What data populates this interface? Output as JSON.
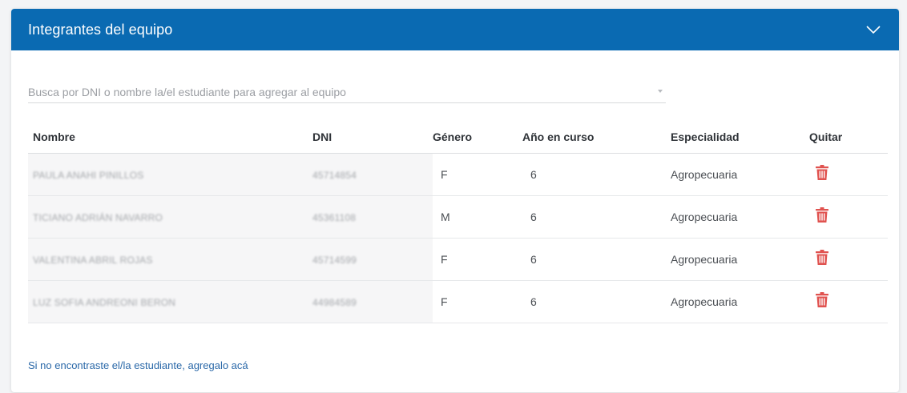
{
  "header": {
    "title": "Integrantes del equipo"
  },
  "search": {
    "placeholder": "Busca por DNI o nombre la/el estudiante para agregar al equipo"
  },
  "table": {
    "columns": [
      "Nombre",
      "DNI",
      "Género",
      "Año en curso",
      "Especialidad",
      "Quitar"
    ],
    "rows": [
      {
        "nombre": "PAULA ANAHI PINILLOS",
        "dni": "45714854",
        "genero": "F",
        "ano": "6",
        "especialidad": "Agropecuaria"
      },
      {
        "nombre": "TICIANO ADRIÁN NAVARRO",
        "dni": "45361108",
        "genero": "M",
        "ano": "6",
        "especialidad": "Agropecuaria"
      },
      {
        "nombre": "VALENTINA ABRIL ROJAS",
        "dni": "45714599",
        "genero": "F",
        "ano": "6",
        "especialidad": "Agropecuaria"
      },
      {
        "nombre": "LUZ SOFIA ANDREONI BERON",
        "dni": "44984589",
        "genero": "F",
        "ano": "6",
        "especialidad": "Agropecuaria"
      }
    ]
  },
  "footer": {
    "add_link": "Si no encontraste el/la estudiante, agregalo acá"
  },
  "icons": {
    "collapse": "chevron-down-icon",
    "remove": "trash-icon"
  },
  "colors": {
    "header_bg": "#0a6ab2",
    "link": "#2a68a8",
    "trash": "#e0524f"
  }
}
